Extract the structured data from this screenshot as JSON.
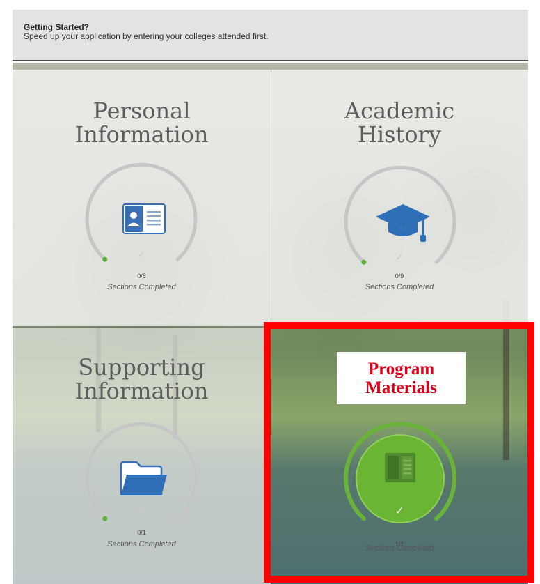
{
  "banner": {
    "title": "Getting Started?",
    "text": "Speed up your application by entering your colleges attended first."
  },
  "tiles": [
    {
      "title_line1": "Personal",
      "title_line2": "Information",
      "count": "0/8",
      "caption": "Sections Completed",
      "progress": 0,
      "icon": "id-card-icon"
    },
    {
      "title_line1": "Academic",
      "title_line2": "History",
      "count": "0/9",
      "caption": "Sections Completed",
      "progress": 0,
      "icon": "graduation-cap-icon"
    },
    {
      "title_line1": "Supporting",
      "title_line2": "Information",
      "count": "0/1",
      "caption": "Sections Completed",
      "progress": 0,
      "icon": "folder-icon"
    },
    {
      "title_line1": "Program",
      "title_line2": "Materials",
      "count": "1/1",
      "caption": "Sections Completed",
      "progress": 1,
      "icon": "book-icon"
    }
  ],
  "colors": {
    "accent_blue": "#3a6fb5",
    "complete_green": "#69b33a",
    "start_dot_green": "#5aae3a",
    "ring_gray": "#c6c6c6",
    "highlight_red": "#ff0000",
    "label_red": "#e0001a"
  }
}
